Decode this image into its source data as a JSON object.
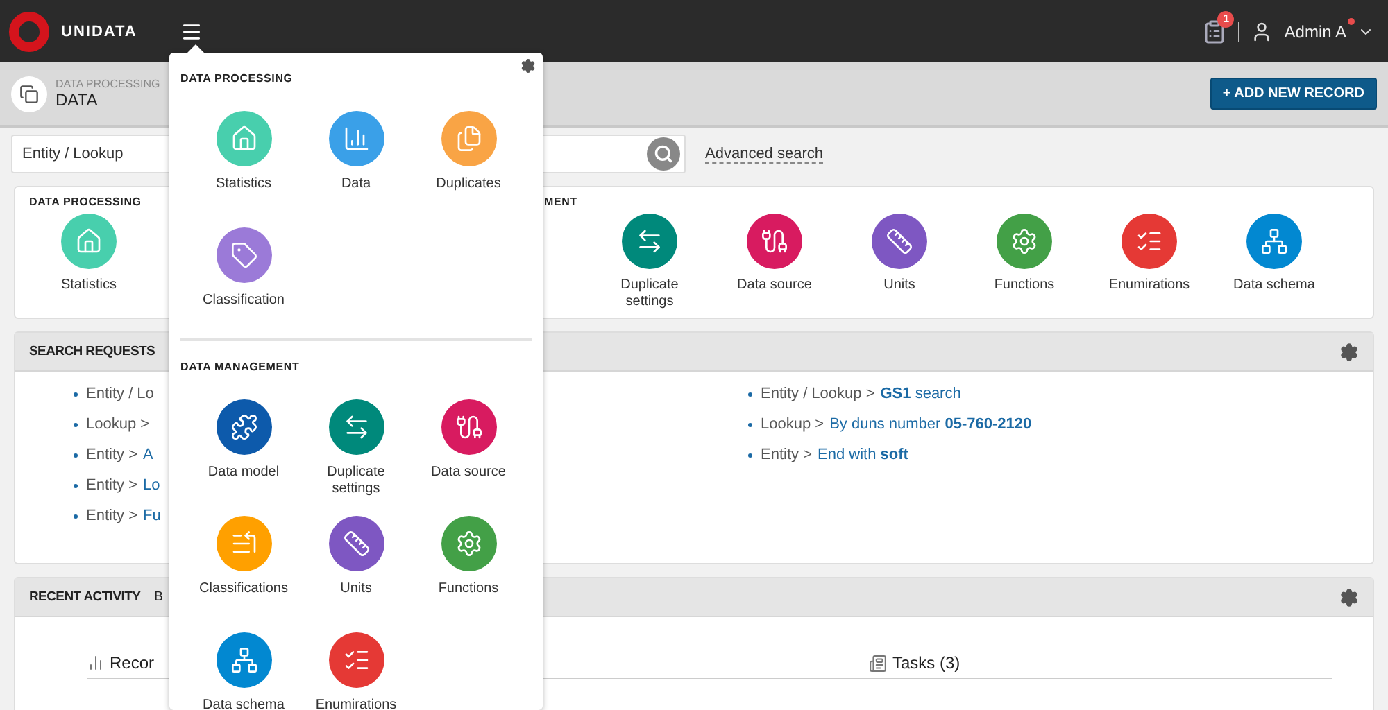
{
  "topbar": {
    "brand": "UNIDATA",
    "tasks_badge": "1",
    "user": "Admin A",
    "user_notice": true
  },
  "breadcrumb": {
    "section": "DATA PROCESSING",
    "title": "DATA"
  },
  "add_button": "+ ADD NEW RECORD",
  "search": {
    "value": "Entity / Lookup",
    "advanced": "Advanced search"
  },
  "modules": {
    "processing_title": "DATA PROCESSING",
    "processing": [
      {
        "kind": "statistics",
        "label": "Statistics",
        "color": "#48cfad"
      }
    ],
    "management_title": "MENT",
    "management": [
      {
        "kind": "duplicate-settings",
        "label": "Duplicate settings",
        "color": "#00897b"
      },
      {
        "kind": "data-source",
        "label": "Data source",
        "color": "#d81b60"
      },
      {
        "kind": "units",
        "label": "Units",
        "color": "#7e57c2"
      },
      {
        "kind": "functions",
        "label": "Functions",
        "color": "#43a047"
      },
      {
        "kind": "enumirations",
        "label": "Enumirations",
        "color": "#e53935"
      },
      {
        "kind": "data-schema",
        "label": "Data schema",
        "color": "#0288d1"
      }
    ]
  },
  "search_requests": {
    "title": "SEARCH REQUESTS",
    "left": [
      {
        "prefix": "Entity / Lo"
      },
      {
        "prefix": "Lookup >"
      },
      {
        "prefix": "Entity >",
        "link": "A"
      },
      {
        "prefix": "Entity >",
        "link": "Lo"
      },
      {
        "prefix": "Entity >",
        "link": "Fu"
      }
    ],
    "right": [
      {
        "prefix": "Entity / Lookup >",
        "link": "**GS1** search"
      },
      {
        "prefix": "Lookup >",
        "link": "By duns number **05-760-2120**"
      },
      {
        "prefix": "Entity >",
        "link": "End with **soft**"
      }
    ]
  },
  "recent_activity": {
    "title": "RECENT ACTIVITY",
    "tab": "B",
    "records": "Recor",
    "tasks": "Tasks (3)"
  },
  "menu": {
    "sections": [
      {
        "title": "DATA PROCESSING",
        "items": [
          {
            "kind": "statistics",
            "label": "Statistics",
            "color": "#48cfad"
          },
          {
            "kind": "data",
            "label": "Data",
            "color": "#3aa0e8"
          },
          {
            "kind": "duplicates",
            "label": "Duplicates",
            "color": "#f9a445"
          },
          {
            "kind": "classification",
            "label": "Classification",
            "color": "#9b7ad8"
          }
        ]
      },
      {
        "title": "DATA MANAGEMENT",
        "items": [
          {
            "kind": "data-model",
            "label": "Data model",
            "color": "#0d5aab"
          },
          {
            "kind": "duplicate-settings",
            "label": "Duplicate settings",
            "color": "#00897b"
          },
          {
            "kind": "data-source",
            "label": "Data source",
            "color": "#d81b60"
          },
          {
            "kind": "classifications",
            "label": "Classifications",
            "color": "#ffa000"
          },
          {
            "kind": "units",
            "label": "Units",
            "color": "#7e57c2"
          },
          {
            "kind": "functions",
            "label": "Functions",
            "color": "#43a047"
          },
          {
            "kind": "data-schema",
            "label": "Data schema",
            "color": "#0288d1"
          },
          {
            "kind": "enumirations",
            "label": "Enumirations",
            "color": "#e53935"
          }
        ]
      }
    ]
  }
}
